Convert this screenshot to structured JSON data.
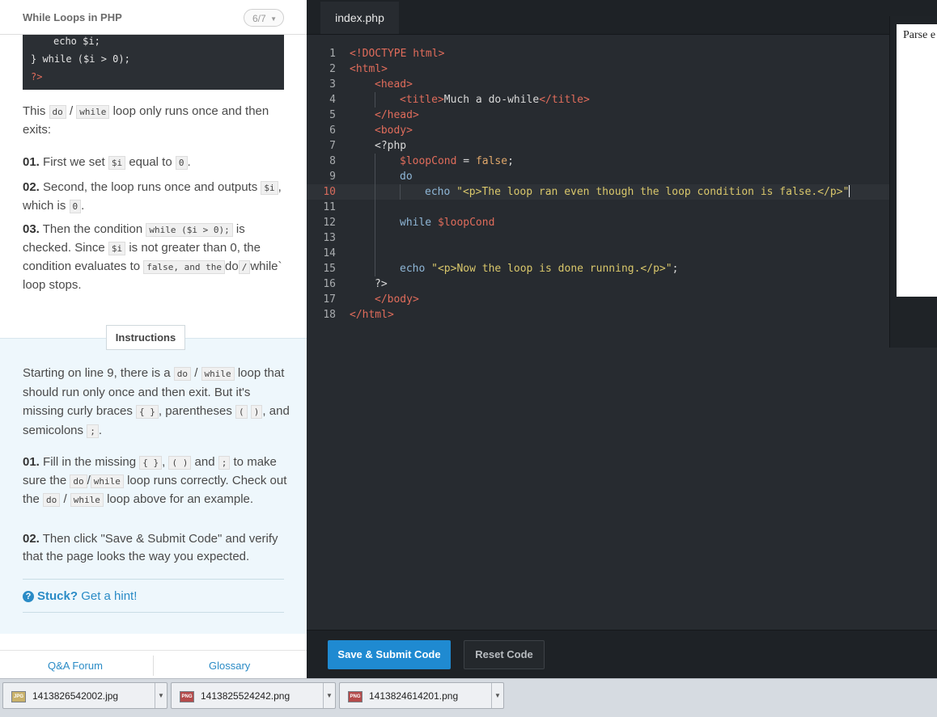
{
  "lesson": {
    "title": "While Loops in PHP",
    "progress": "6/7",
    "example_lines": [
      "echo $i;",
      "} while ($i > 0);",
      "?>"
    ],
    "intro_1": "This",
    "intro_do": "do",
    "intro_slash": "/",
    "intro_while": "while",
    "intro_2": "loop only runs once and then exits:",
    "steps": [
      {
        "num": "01.",
        "t1": "First we set",
        "c1": "$i",
        "t2": "equal to",
        "c2": "0",
        "t3": "."
      },
      {
        "num": "02.",
        "t1": "Second, the loop runs once and outputs",
        "c1": "$i",
        "t2": ", which is",
        "c2": "0",
        "t3": "."
      },
      {
        "num": "03.",
        "t1": "Then the condition",
        "c1": "while ($i > 0);",
        "t2": "is checked. Since",
        "c2": "$i",
        "t3": "is not greater than 0, the condition evaluates to",
        "c3": "false, and the",
        "t4": "do",
        "t5": "/",
        "t6": "while` loop stops."
      }
    ]
  },
  "instructions": {
    "tab_label": "Instructions",
    "p1_a": "Starting on line 9, there is a",
    "p1_do": "do",
    "p1_slash": "/",
    "p1_while": "while",
    "p1_b": "loop that should run only once and then exit. But it's missing curly braces",
    "p1_braces": "{ }",
    "p1_c": ", parentheses",
    "p1_paren_open": "(",
    "p1_paren_close": ")",
    "p1_d": ", and semicolons",
    "p1_semi": ";",
    "p1_e": ".",
    "s1_num": "01.",
    "s1_a": "Fill in the missing",
    "s1_braces": "{ }",
    "s1_comma": ",",
    "s1_parens": "( )",
    "s1_and": "and",
    "s1_semi": ";",
    "s1_b": "to make sure the",
    "s1_do": "do",
    "s1_slash": "/",
    "s1_while": "while",
    "s1_c": "loop runs correctly. Check out the",
    "s1_do2": "do",
    "s1_slash2": "/",
    "s1_while2": "while",
    "s1_d": "loop above for an example.",
    "s2_num": "02.",
    "s2_text": "Then click \"Save & Submit Code\" and verify that the page looks the way you expected.",
    "hint_stuck": "Stuck?",
    "hint_link": "Get a hint!"
  },
  "footer_links": {
    "qa": "Q&A Forum",
    "glossary": "Glossary"
  },
  "editor": {
    "tab": "index.php",
    "submit": "Save & Submit Code",
    "reset": "Reset Code",
    "preview_text": "Parse e",
    "active_line": 10,
    "lines": [
      "1",
      "2",
      "3",
      "4",
      "5",
      "6",
      "7",
      "8",
      "9",
      "10",
      "11",
      "12",
      "13",
      "14",
      "15",
      "16",
      "17",
      "18"
    ],
    "code": {
      "l1": "<!DOCTYPE html>",
      "l2": "<html>",
      "l3": "<head>",
      "l4_open": "<title>",
      "l4_text": "Much a do-while",
      "l4_close": "</title>",
      "l5": "</head>",
      "l6": "<body>",
      "l7": "<?php",
      "l8_var": "$loopCond",
      "l8_eq": " = ",
      "l8_val": "false",
      "l8_semi": ";",
      "l9": "do",
      "l10_kw": "echo",
      "l10_str": "\"<p>The loop ran even though the loop condition is false.</p>\"",
      "l12_kw": "while",
      "l12_var": "$loopCond",
      "l15_kw": "echo",
      "l15_str": "\"<p>Now the loop is done running.</p>\"",
      "l15_semi": ";",
      "l16": "?>",
      "l17": "</body>",
      "l18": "</html>"
    }
  },
  "downloads": [
    {
      "name": "1413826542002.jpg",
      "type": "JPG"
    },
    {
      "name": "1413825524242.png",
      "type": "PNG"
    },
    {
      "name": "1413824614201.png",
      "type": "PNG"
    }
  ],
  "colors": {
    "accent": "#1f8ad1",
    "editor_bg": "#272b30",
    "instructions_bg": "#eef7fc"
  }
}
